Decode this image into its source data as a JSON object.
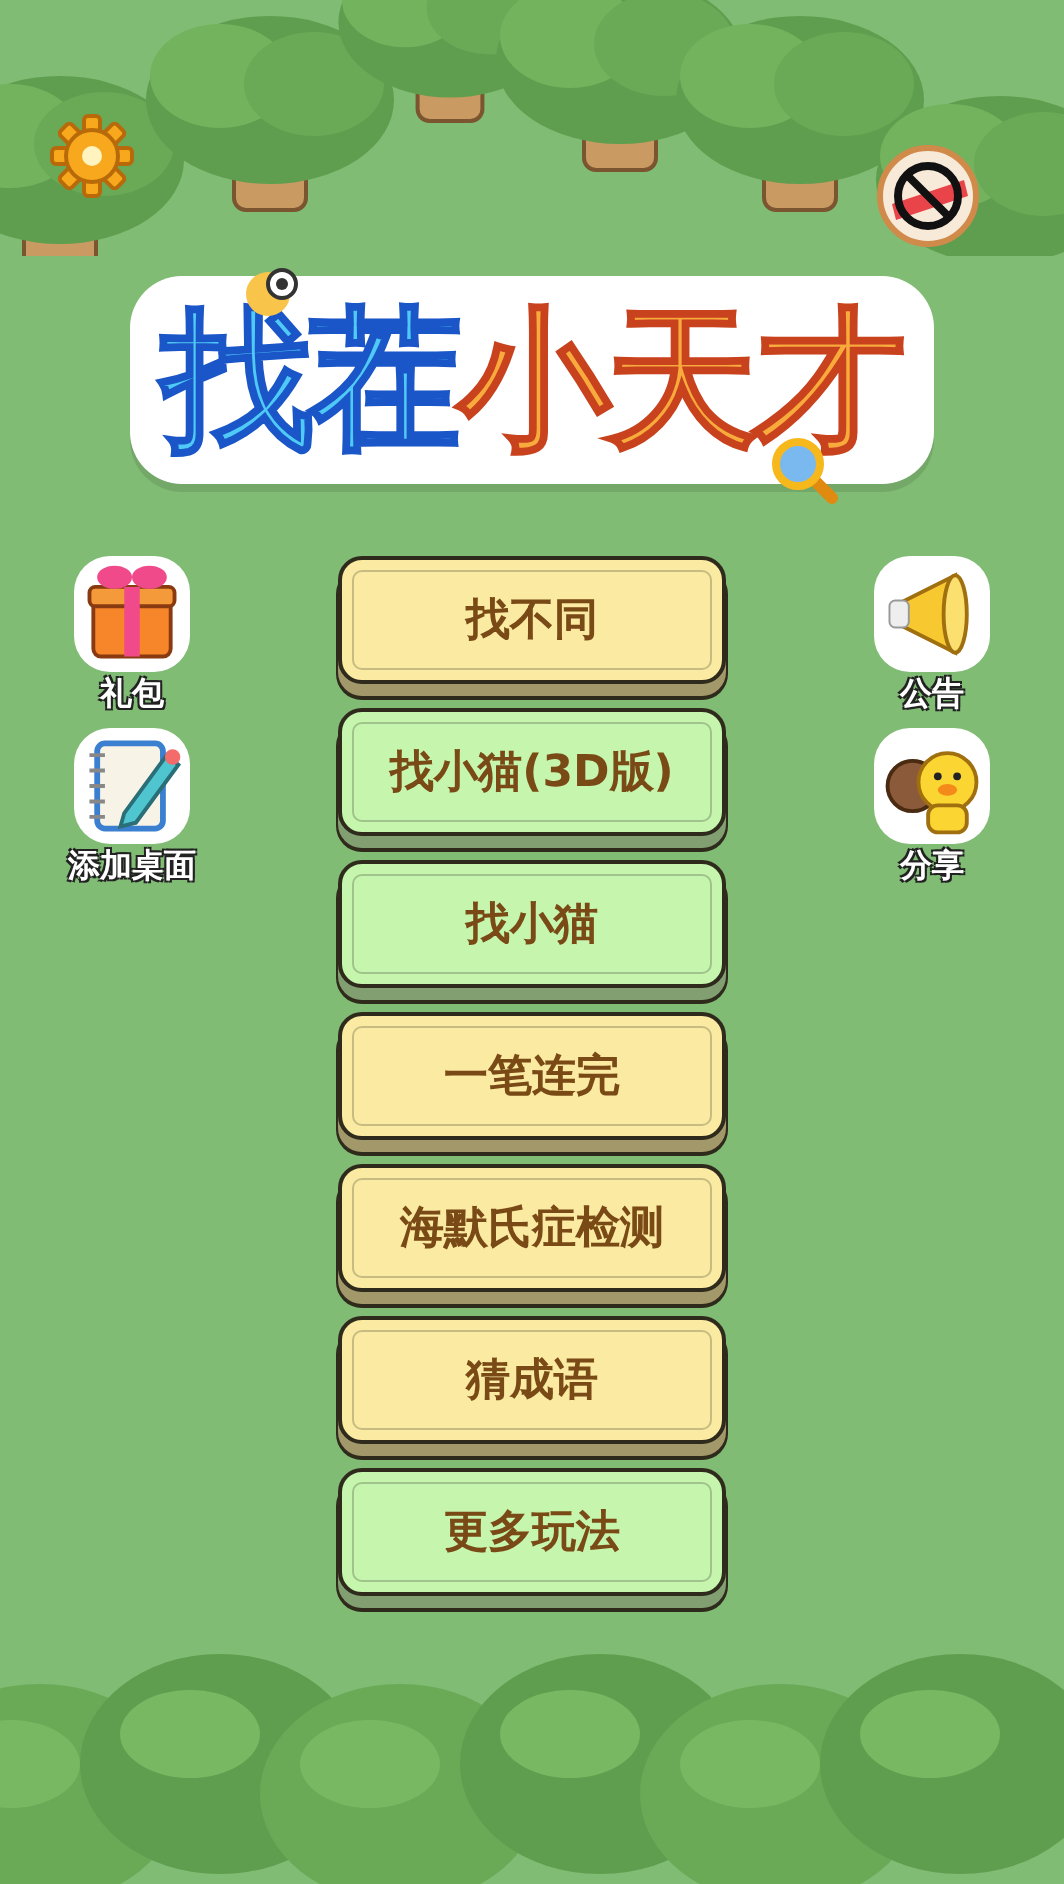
{
  "title": [
    {
      "text": "找茬",
      "color": "#4fcaf6"
    },
    {
      "text": "小天才",
      "color": "#f8aa3c"
    }
  ],
  "side_left": [
    {
      "label": "礼包",
      "kind": "gift"
    },
    {
      "label": "添加桌面",
      "kind": "notebook"
    }
  ],
  "side_right": [
    {
      "label": "公告",
      "kind": "megaphone"
    },
    {
      "label": "分享",
      "kind": "friends"
    }
  ],
  "menu": [
    {
      "label": "找不同",
      "color": "#faeaa2"
    },
    {
      "label": "找小猫(3D版)",
      "color": "#c6f5ae"
    },
    {
      "label": "找小猫",
      "color": "#c6f5ae"
    },
    {
      "label": "一笔连完",
      "color": "#faeaa2"
    },
    {
      "label": "海默氏症检测",
      "color": "#faeaa2"
    },
    {
      "label": "猜成语",
      "color": "#faeaa2"
    },
    {
      "label": "更多玩法",
      "color": "#c6f5ae"
    }
  ]
}
